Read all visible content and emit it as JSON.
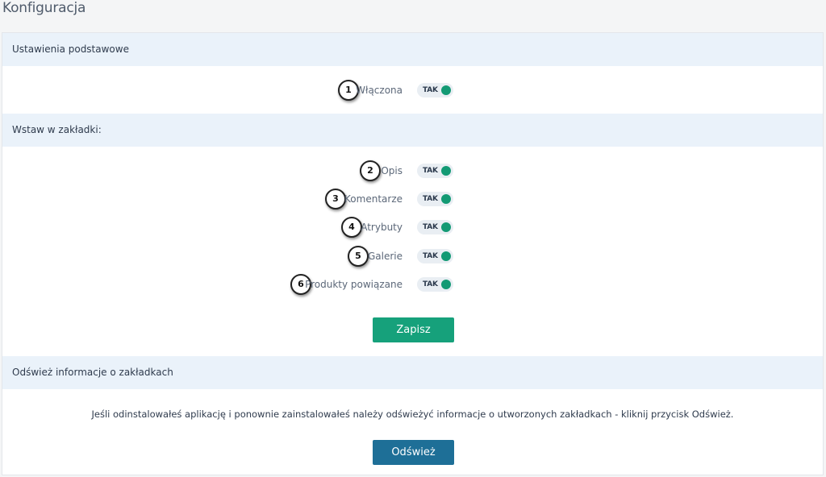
{
  "page_title": "Konfiguracja",
  "sections": {
    "basic": {
      "header": "Ustawienia podstawowe",
      "rows": [
        {
          "badge": "1",
          "label": "Włączona",
          "toggle": "TAK"
        }
      ]
    },
    "tabs": {
      "header": "Wstaw w zakładki:",
      "rows": [
        {
          "badge": "2",
          "label": "Opis",
          "toggle": "TAK"
        },
        {
          "badge": "3",
          "label": "Komentarze",
          "toggle": "TAK"
        },
        {
          "badge": "4",
          "label": "Atrybuty",
          "toggle": "TAK"
        },
        {
          "badge": "5",
          "label": "Galerie",
          "toggle": "TAK"
        },
        {
          "badge": "6",
          "label": "Produkty powiązane",
          "toggle": "TAK"
        }
      ],
      "save_label": "Zapisz"
    },
    "refresh": {
      "header": "Odśwież informacje o zakładkach",
      "info": "Jeśli odinstalowałeś aplikację i ponownie zainstalowałeś należy odświeżyć informacje o utworzonych zakładkach - kliknij przycisk Odśwież.",
      "refresh_label": "Odśwież"
    }
  },
  "colors": {
    "toggle_on": "#139a74",
    "save_button": "#16a17b",
    "refresh_button": "#1e6f97",
    "section_header_bg": "#eaf2fa"
  }
}
